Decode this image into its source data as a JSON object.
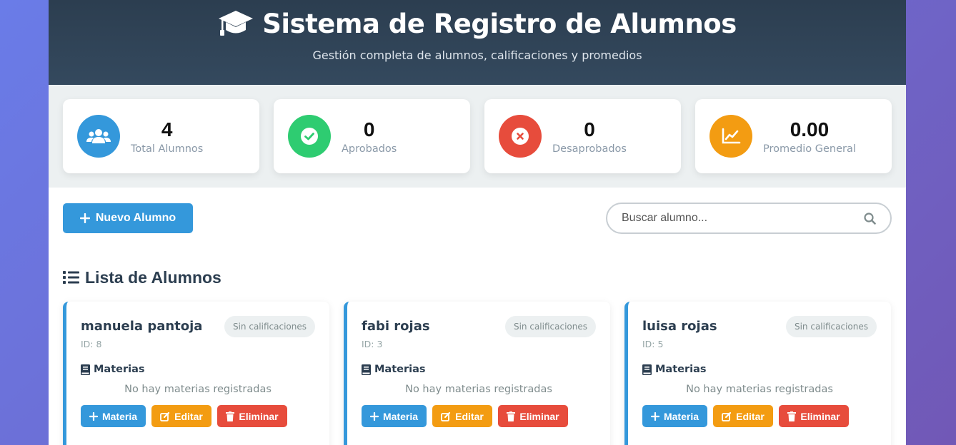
{
  "header": {
    "title": "Sistema de Registro de Alumnos",
    "subtitle": "Gestión completa de alumnos, calificaciones y promedios",
    "icon": "graduation-cap-icon"
  },
  "stats": [
    {
      "value": "4",
      "label": "Total Alumnos",
      "icon": "users-icon",
      "color": "#3498db"
    },
    {
      "value": "0",
      "label": "Aprobados",
      "icon": "check-circle-icon",
      "color": "#2ecc71"
    },
    {
      "value": "0",
      "label": "Desaprobados",
      "icon": "times-circle-icon",
      "color": "#e74c3c"
    },
    {
      "value": "0.00",
      "label": "Promedio General",
      "icon": "chart-line-icon",
      "color": "#f39c12"
    }
  ],
  "controls": {
    "new_button": "Nuevo Alumno",
    "search_placeholder": "Buscar alumno..."
  },
  "list": {
    "title": "Lista de Alumnos",
    "students": [
      {
        "name": "manuela pantoja",
        "id": "ID: 8",
        "badge": "Sin calificaciones",
        "materias_title": "Materias",
        "empty": "No hay materias registradas"
      },
      {
        "name": "fabi rojas",
        "id": "ID: 3",
        "badge": "Sin calificaciones",
        "materias_title": "Materias",
        "empty": "No hay materias registradas"
      },
      {
        "name": "luisa rojas",
        "id": "ID: 5",
        "badge": "Sin calificaciones",
        "materias_title": "Materias",
        "empty": "No hay materias registradas"
      }
    ],
    "actions": {
      "add": "Materia",
      "edit": "Editar",
      "delete": "Eliminar"
    }
  },
  "colors": {
    "primary": "#3498db",
    "success": "#2ecc71",
    "danger": "#e74c3c",
    "warning": "#f39c12",
    "header": "#2c3e50"
  }
}
